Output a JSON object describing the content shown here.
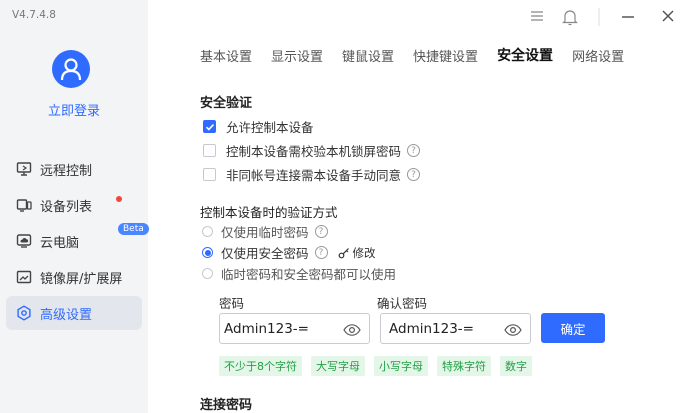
{
  "app": {
    "version": "V4.7.4.8"
  },
  "account": {
    "login_label": "立即登录"
  },
  "sidebar": {
    "items": [
      {
        "label": "远程控制",
        "icon": "monitor-icon"
      },
      {
        "label": "设备列表",
        "icon": "devices-icon",
        "badge_dot": true
      },
      {
        "label": "云电脑",
        "icon": "cloud-pc-icon",
        "badge": "Beta"
      },
      {
        "label": "镜像屏/扩展屏",
        "icon": "mirror-screen-icon"
      },
      {
        "label": "高级设置",
        "icon": "settings-icon",
        "active": true
      }
    ]
  },
  "tabs": [
    {
      "label": "基本设置"
    },
    {
      "label": "显示设置"
    },
    {
      "label": "键鼠设置"
    },
    {
      "label": "快捷键设置"
    },
    {
      "label": "安全设置",
      "active": true
    },
    {
      "label": "网络设置"
    }
  ],
  "security": {
    "title": "安全验证",
    "options": [
      {
        "label": "允许控制本设备",
        "checked": true
      },
      {
        "label": "控制本设备需校验本机锁屏密码",
        "checked": false,
        "help": true
      },
      {
        "label": "非同帐号连接需本设备手动同意",
        "checked": false,
        "help": true
      }
    ]
  },
  "verify": {
    "title": "控制本设备时的验证方式",
    "options": [
      {
        "label": "仅使用临时密码",
        "selected": false,
        "help": true
      },
      {
        "label": "仅使用安全密码",
        "selected": true,
        "help": true,
        "action": "修改"
      },
      {
        "label": "临时密码和安全密码都可以使用",
        "selected": false
      }
    ]
  },
  "password": {
    "label": "密码",
    "value": "Admin123-=",
    "confirm_label": "确认密码",
    "confirm_value": "Admin123-=",
    "confirm_button": "确定",
    "rules": [
      "不少于8个字符",
      "大写字母",
      "小写字母",
      "特殊字符",
      "数字"
    ]
  },
  "connect": {
    "title": "连接密码"
  },
  "colors": {
    "accent": "#2f6bff",
    "rule_bg": "#e3f6e8",
    "rule_text": "#22a046",
    "dot": "#f5463c"
  }
}
